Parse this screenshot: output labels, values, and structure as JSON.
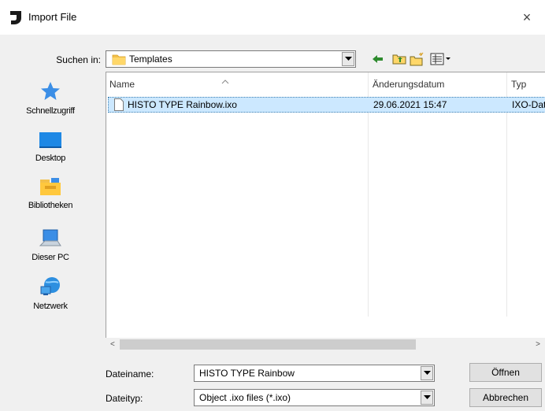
{
  "window": {
    "title": "Import File",
    "close_glyph": "×"
  },
  "lookin": {
    "label": "Suchen in:",
    "value": "Templates"
  },
  "toolbar": {
    "icons": [
      "back-arrow-icon",
      "up-folder-icon",
      "new-folder-icon",
      "view-menu-icon"
    ]
  },
  "places": [
    {
      "label": "Schnellzugriff",
      "icon": "quick-access-icon"
    },
    {
      "label": "Desktop",
      "icon": "desktop-icon"
    },
    {
      "label": "Bibliotheken",
      "icon": "libraries-icon"
    },
    {
      "label": "Dieser PC",
      "icon": "this-pc-icon"
    },
    {
      "label": "Netzwerk",
      "icon": "network-icon"
    }
  ],
  "columns": {
    "name": "Name",
    "date": "Änderungsdatum",
    "type": "Typ"
  },
  "files": [
    {
      "name": "HISTO TYPE Rainbow.ixo",
      "date": "29.06.2021 15:47",
      "type": "IXO-Datei"
    }
  ],
  "filename": {
    "label": "Dateiname:",
    "value": "HISTO TYPE Rainbow"
  },
  "filetype": {
    "label": "Dateityp:",
    "value": "Object .ixo files (*.ixo)"
  },
  "buttons": {
    "open": "Öffnen",
    "cancel": "Abbrechen"
  },
  "scroll": {
    "left": "<",
    "right": ">"
  },
  "colors": {
    "selection": "#cce8ff",
    "selection_border": "#3c7fb1",
    "accent_blue": "#1e90ff"
  }
}
